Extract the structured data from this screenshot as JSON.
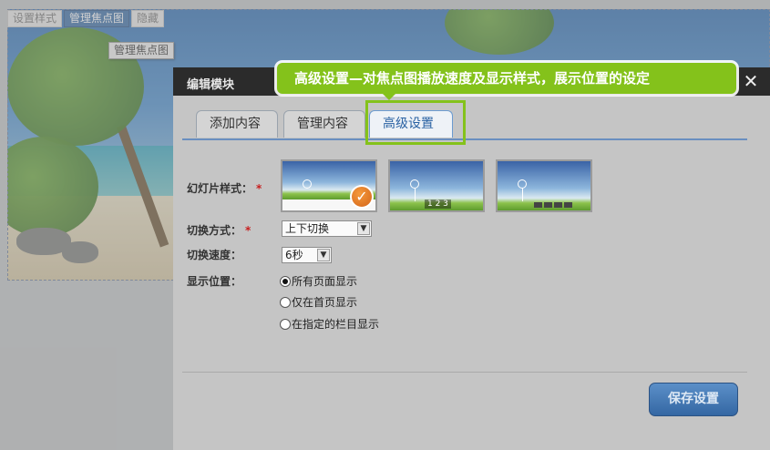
{
  "top_toolbar": {
    "buttons": [
      "设置样式",
      "管理焦点图",
      "隐藏"
    ],
    "tooltip": "管理焦点图"
  },
  "modal": {
    "title": "编辑模块",
    "close_icon": "close-icon",
    "tabs": [
      {
        "label": "添加内容",
        "active": false
      },
      {
        "label": "管理内容",
        "active": false
      },
      {
        "label": "高级设置",
        "active": true
      }
    ],
    "callout": "高级设置—对焦点图播放速度及显示样式，展示位置的设定",
    "fields": {
      "slide_style_label": "幻灯片样式：",
      "required_mark": "*",
      "thumbnail_2_nums": "1 2 3",
      "transition_label": "切换方式：",
      "transition_value": "上下切换",
      "speed_label": "切换速度：",
      "speed_value": "6秒",
      "position_label": "显示位置：",
      "position_options": [
        {
          "label": "所有页面显示",
          "checked": true
        },
        {
          "label": "仅在首页显示",
          "checked": false
        },
        {
          "label": "在指定的栏目显示",
          "checked": false
        }
      ]
    },
    "save_button": "保存设置"
  },
  "colors": {
    "accent_green": "#84c21b",
    "tab_active_text": "#2a62a3",
    "header_bg": "#2b2b2b",
    "button_blue": "#3467a3"
  }
}
